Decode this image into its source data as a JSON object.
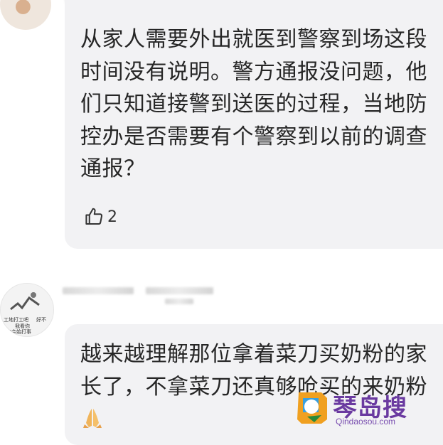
{
  "comments": [
    {
      "text": "从家人需要外出就医到警察到场这段时间没有说明。警方通报没问题，他们只知道接警到送医的过程，当地防控办是否需要有个警察到以前的调查通报？",
      "likes": "2"
    },
    {
      "text": "越来越理解那位拿着菜刀买奶粉的家长了，不拿菜刀还真够呛买的来奶粉",
      "avatar_text": [
        "工地打工吧",
        "好不",
        "我看你",
        "每会始打事"
      ]
    }
  ],
  "watermark": {
    "name": "琴岛搜",
    "domain": "Qindaosou.com"
  },
  "colors": {
    "bubble": "#f2f2f4",
    "text": "#262626",
    "watermark": "#6a3aa0"
  }
}
